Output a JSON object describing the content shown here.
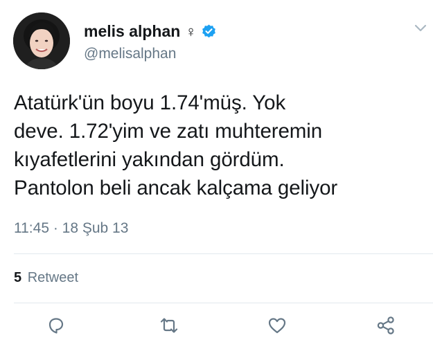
{
  "tweet": {
    "display_name": "melis alphan",
    "gender_symbol": "♀",
    "handle": "@melisalphan",
    "text_lines": [
      "Atatürk'ün boyu 1.74'müş. Yok",
      "deve. 1.72'yim ve zatı muhteremin",
      "kıyafetlerini yakından gördüm.",
      "Pantolon beli ancak kalçama geliyor"
    ],
    "timestamp": "11:45 · 18 Şub 13",
    "retweet_count": "5",
    "retweet_label": "Retweet"
  },
  "icons": {
    "verified": "verified-badge-icon",
    "menu": "chevron-down-icon",
    "reply": "reply-icon",
    "retweet": "retweet-icon",
    "like": "heart-icon",
    "share": "share-icon"
  },
  "colors": {
    "accent": "#1da1f2",
    "secondary_text": "#657786",
    "primary_text": "#14171a",
    "divider": "#e1e8ed"
  }
}
